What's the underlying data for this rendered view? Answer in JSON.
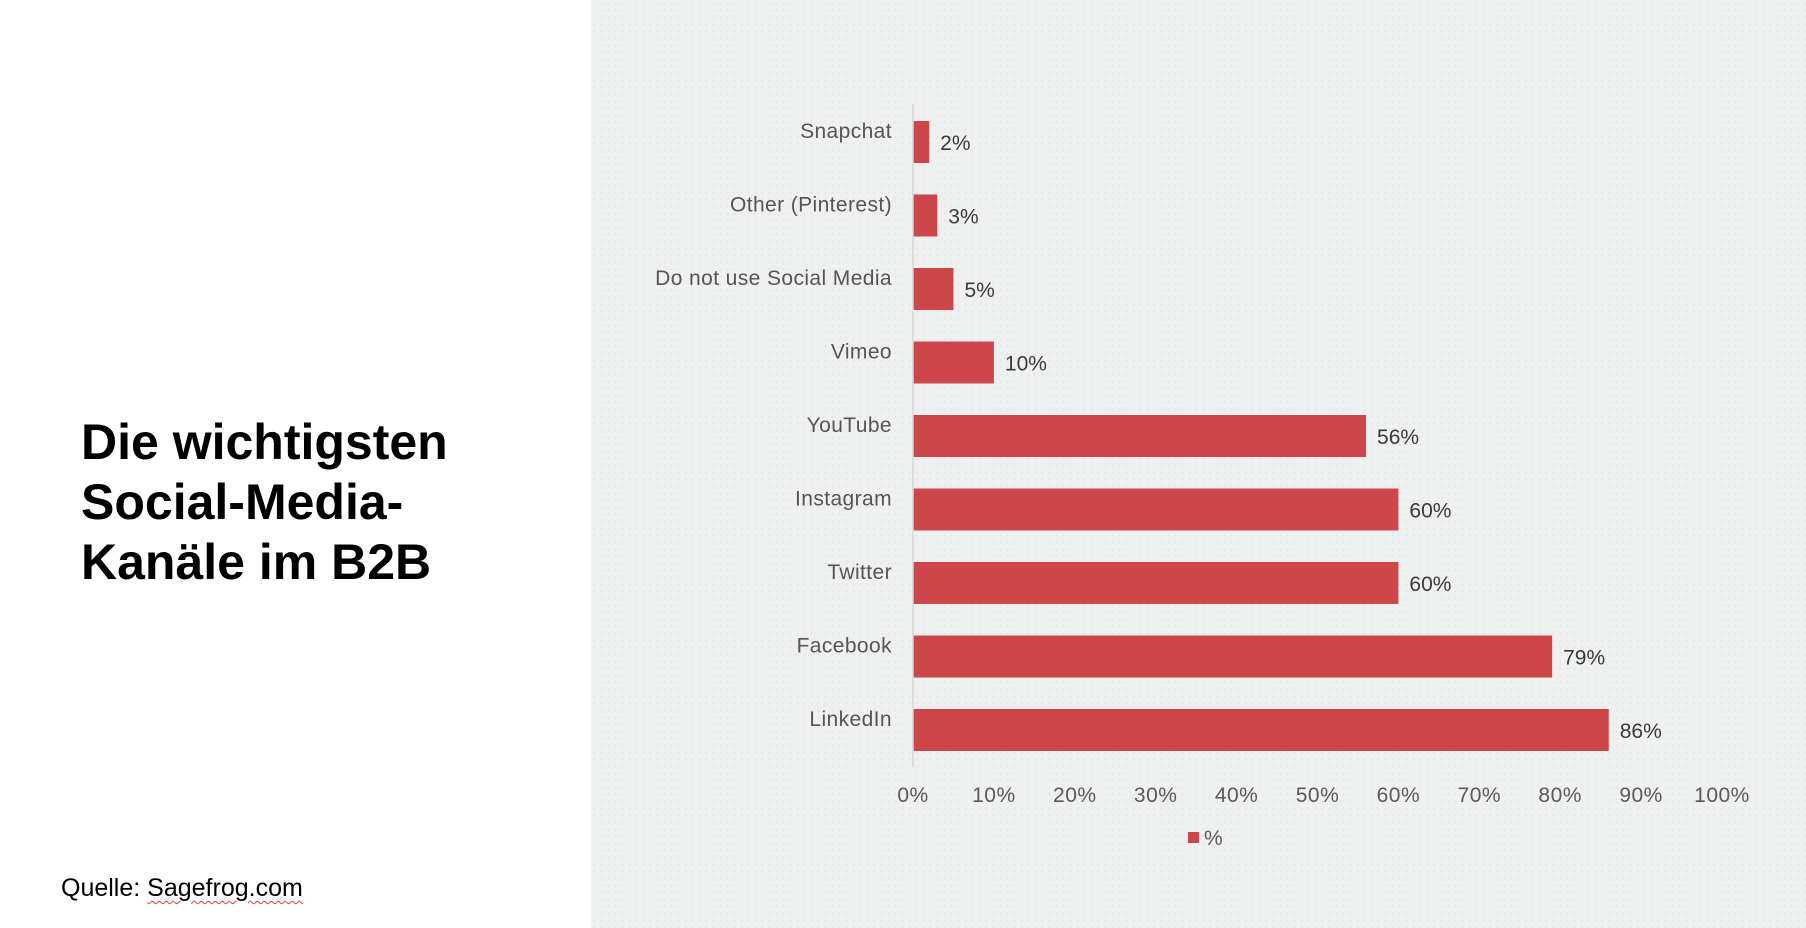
{
  "slide": {
    "title_lines": [
      "Die wichtigsten",
      "Social-Media-",
      "Kanäle im B2B"
    ],
    "source_prefix": "Quelle: ",
    "source_link": "Sagefrog.com"
  },
  "colors": {
    "bar": "#cc464a",
    "chart_background": "#eff0f0",
    "axis_line": "#d6d6d6"
  },
  "chart_data": {
    "type": "bar",
    "orientation": "horizontal",
    "title": "",
    "xlabel": "",
    "ylabel": "",
    "categories": [
      "Snapchat",
      "Other (Pinterest)",
      "Do not use Social Media",
      "Vimeo",
      "YouTube",
      "Instagram",
      "Twitter",
      "Facebook",
      "LinkedIn"
    ],
    "series": [
      {
        "name": "%",
        "values": [
          2,
          3,
          5,
          10,
          56,
          60,
          60,
          79,
          86
        ]
      }
    ],
    "value_labels": [
      "2%",
      "3%",
      "5%",
      "10%",
      "56%",
      "60%",
      "60%",
      "79%",
      "86%"
    ],
    "xlim": [
      0,
      100
    ],
    "x_ticks": [
      0,
      10,
      20,
      30,
      40,
      50,
      60,
      70,
      80,
      90,
      100
    ],
    "x_tick_labels": [
      "0%",
      "10%",
      "20%",
      "30%",
      "40%",
      "50%",
      "60%",
      "70%",
      "80%",
      "90%",
      "100%"
    ],
    "grid": false,
    "legend": {
      "position": "bottom",
      "entries": [
        "%"
      ]
    }
  }
}
